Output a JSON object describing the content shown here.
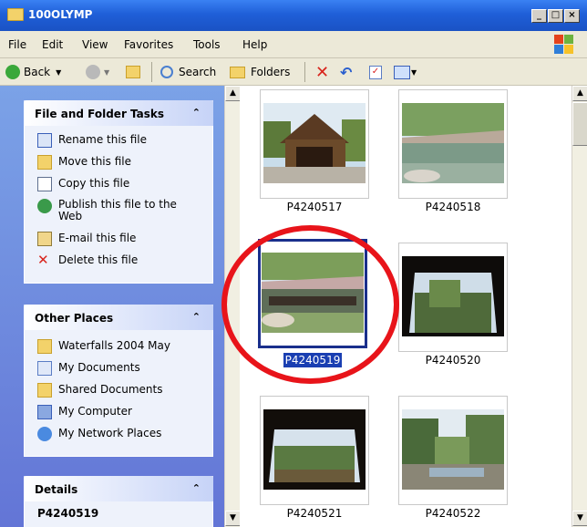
{
  "window": {
    "title": "100OLYMP",
    "controls": [
      "_",
      "□",
      "×"
    ]
  },
  "menu": [
    {
      "label": "File"
    },
    {
      "label": "Edit"
    },
    {
      "label": "View"
    },
    {
      "label": "Favorites"
    },
    {
      "label": "Tools"
    },
    {
      "label": "Help"
    }
  ],
  "toolbar": {
    "back_label": "Back",
    "search_label": "Search",
    "folders_label": "Folders"
  },
  "file_tasks": {
    "title": "File and Folder Tasks",
    "items": [
      {
        "label": "Rename this file",
        "icon": "rename-icon"
      },
      {
        "label": "Move this file",
        "icon": "move-icon"
      },
      {
        "label": "Copy this file",
        "icon": "copy-icon"
      },
      {
        "label": "Publish this file to the Web",
        "icon": "publish-icon"
      },
      {
        "label": "E-mail this file",
        "icon": "email-icon"
      },
      {
        "label": "Delete this file",
        "icon": "delete-icon"
      }
    ]
  },
  "other_places": {
    "title": "Other Places",
    "items": [
      {
        "label": "Waterfalls 2004 May",
        "icon": "folder-icon"
      },
      {
        "label": "My Documents",
        "icon": "documents-icon"
      },
      {
        "label": "Shared Documents",
        "icon": "folder-icon"
      },
      {
        "label": "My Computer",
        "icon": "computer-icon"
      },
      {
        "label": "My Network Places",
        "icon": "network-icon"
      }
    ]
  },
  "details": {
    "title": "Details",
    "filename": "P4240519"
  },
  "thumbnails": [
    {
      "name": "P4240517",
      "selected": false
    },
    {
      "name": "P4240518",
      "selected": false
    },
    {
      "name": "P4240519",
      "selected": true
    },
    {
      "name": "P4240520",
      "selected": false
    },
    {
      "name": "P4240521",
      "selected": false
    },
    {
      "name": "P4240522",
      "selected": false
    }
  ],
  "colors": {
    "titlebar": "#1f5fd8",
    "selection": "#1a3fb2",
    "annotation_ring": "#e8141a"
  }
}
